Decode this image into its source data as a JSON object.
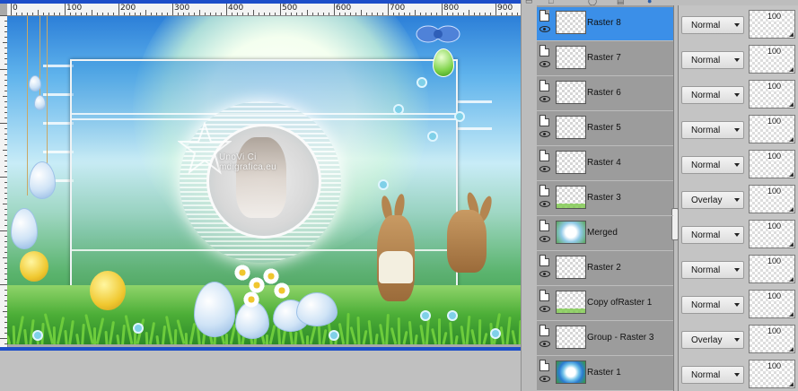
{
  "ruler": {
    "labels": [
      "0",
      "100",
      "200",
      "300",
      "400",
      "500",
      "600",
      "700",
      "800",
      "900"
    ]
  },
  "canvas": {
    "watermark": "UnoVi Ci\nmdigrafica.eu"
  },
  "layers": [
    {
      "name": "Raster 8",
      "blend": "Normal",
      "opacity": "100",
      "selected": true,
      "thumb": "empty"
    },
    {
      "name": "Raster 7",
      "blend": "Normal",
      "opacity": "100",
      "selected": false,
      "thumb": "empty"
    },
    {
      "name": "Raster 6",
      "blend": "Normal",
      "opacity": "100",
      "selected": false,
      "thumb": "empty"
    },
    {
      "name": "Raster 5",
      "blend": "Normal",
      "opacity": "100",
      "selected": false,
      "thumb": "empty"
    },
    {
      "name": "Raster 4",
      "blend": "Normal",
      "opacity": "100",
      "selected": false,
      "thumb": "empty"
    },
    {
      "name": "Raster 3",
      "blend": "Overlay",
      "opacity": "100",
      "selected": false,
      "thumb": "grass"
    },
    {
      "name": "Merged",
      "blend": "Normal",
      "opacity": "100",
      "selected": false,
      "thumb": "merged"
    },
    {
      "name": "Raster 2",
      "blend": "Normal",
      "opacity": "100",
      "selected": false,
      "thumb": "empty"
    },
    {
      "name": "Copy ofRaster 1",
      "blend": "Normal",
      "opacity": "100",
      "selected": false,
      "thumb": "grass"
    },
    {
      "name": "Group - Raster 3",
      "blend": "Overlay",
      "opacity": "100",
      "selected": false,
      "thumb": "empty"
    },
    {
      "name": "Raster 1",
      "blend": "Normal",
      "opacity": "100",
      "selected": false,
      "thumb": "raster1"
    }
  ],
  "colors": {
    "selection": "#3b8fe8",
    "title_bar": "#1d4ec9"
  }
}
